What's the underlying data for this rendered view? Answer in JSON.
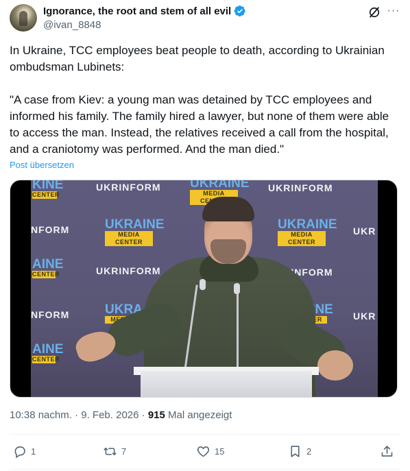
{
  "author": {
    "display_name": "Ignorance, the root and stem of all evil",
    "handle": "@ivan_8848",
    "verified": true,
    "avatar_icon": "avatar-image"
  },
  "header_actions": {
    "grok_icon": "grok-icon",
    "more_icon": "more-dots-icon",
    "more_label": "···"
  },
  "tweet": {
    "paragraph_1": "In Ukraine, TCC employees beat people to death, according to Ukrainian ombudsman Lubinets:",
    "paragraph_2": "\"A case from Kiev: a young man was detained by TCC employees and informed his family. The family hired a lawyer, but none of them were able to access the man. Instead, the relatives received a call from the hospital, and a craniotomy was performed. And the man died.\"",
    "translate_label": "Post übersetzen"
  },
  "media": {
    "watermark_1": "UKRINFORM",
    "watermark_2": "UKRINFORM",
    "watermark_3": "UKRINFORM",
    "watermark_4": "UKRINFORM",
    "watermark_partial_1": "NFORM",
    "watermark_partial_2": "NFORM",
    "watermark_partial_3": "RM",
    "watermark_partial_4": "UKR",
    "watermark_partial_5": "UKR",
    "logo_word": "UKRAINE",
    "logo_sub": "MEDIA CENTER",
    "logo_partial_top_1": "KINE",
    "logo_partial_top_sub": "CENTER",
    "logo_partial_left_1": "AINE",
    "logo_partial_left_sub": "CENTER",
    "logo_partial_left_2": "AINE",
    "logo_partial_left_sub_2": "CENTER",
    "logo_partial_mid_1": "UKRA",
    "logo_partial_mid_sub": "MEDIA",
    "logo_partial_right_1": "KRAINE",
    "logo_partial_right_sub": "A CENTER"
  },
  "meta": {
    "time": "10:38 nachm.",
    "separator": "·",
    "date": "9. Feb. 2026",
    "separator_2": "·",
    "views": "915",
    "views_label": "Mal angezeigt"
  },
  "actions": {
    "reply_count": "1",
    "repost_count": "7",
    "like_count": "15",
    "bookmark_count": "2"
  },
  "colors": {
    "text": "#0f1419",
    "secondary": "#536471",
    "accent": "#1d9bf0",
    "divider": "#eff3f4"
  }
}
